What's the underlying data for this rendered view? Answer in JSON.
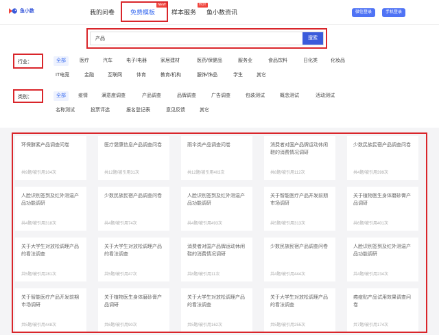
{
  "header": {
    "logo_text": "鱼小数",
    "nav": [
      {
        "label": "我的问卷"
      },
      {
        "label": "免费模板",
        "badge": "NEW"
      },
      {
        "label": "样本服务",
        "badge": "HOT"
      },
      {
        "label": "鱼小数资讯"
      }
    ],
    "login_wechat": "微信登录",
    "login_phone": "手机登录"
  },
  "search": {
    "value": "产品",
    "button": "搜索"
  },
  "industry": {
    "label": "行业：",
    "items": [
      "全部",
      "医疗",
      "汽车",
      "电子/电器",
      "家居建材",
      "医药/保健品",
      "服务业",
      "食品饮料",
      "日化类",
      "化妆品",
      "IT电竞",
      "金融",
      "互联网",
      "体育",
      "教育/机构",
      "服饰/饰品",
      "学生",
      "其它"
    ]
  },
  "category": {
    "label": "类别：",
    "items": [
      "全部",
      "疫情",
      "满意度调查",
      "产品调查",
      "品牌调查",
      "广告调查",
      "包装测试",
      "概念测试",
      "活动测试",
      "名称测试",
      "投票评选",
      "报名登记表",
      "意见反馈",
      "其它"
    ]
  },
  "cards": [
    {
      "title": "环保酵素产品调查问卷",
      "meta": "共9题/被引用104次"
    },
    {
      "title": "医疗健康信息产品调查问卷",
      "meta": "共12题/被引用31次"
    },
    {
      "title": "雨伞类产品调查问卷",
      "meta": "共12题/被引用403次"
    },
    {
      "title": "消费者对国产品牌运动休闲鞋的消费情况调研",
      "meta": "共8题/被引用112次"
    },
    {
      "title": "少数民族民宿产品调查问卷",
      "meta": "共4题/被引用399次"
    },
    {
      "title": "人脸识别签到及红外测温产品功能调研",
      "meta": "共4题/被引用318次"
    },
    {
      "title": "少数民族民宿产品调查问卷",
      "meta": "共4题/被引用74次"
    },
    {
      "title": "人脸识别签到及红外测温产品功能调研",
      "meta": "共4题/被引用493次"
    },
    {
      "title": "关于智能医疗产品开发前期市场调研",
      "meta": "共5题/被引用313次"
    },
    {
      "title": "关于植物医生身体磨砂膏产品调研",
      "meta": "共6题/被引用401次"
    },
    {
      "title": "关于大学生对放松调理产品的看法调查",
      "meta": "共5题/被引用281次"
    },
    {
      "title": "关于大学生对放松调理产品的看法调查",
      "meta": "共5题/被引用47次"
    },
    {
      "title": "消费者对国产品牌运动休闲鞋的消费情况调研",
      "meta": "共8题/被引用11次"
    },
    {
      "title": "少数民族民宿产品调查问卷",
      "meta": "共4题/被引用444次"
    },
    {
      "title": "人脸识别签到及红外测温产品功能调研",
      "meta": "共4题/被引用234次"
    },
    {
      "title": "关于智能医疗产品开发前期市场调研",
      "meta": "共5题/被引用448次"
    },
    {
      "title": "关于植物医生身体磨砂膏产品调研",
      "meta": "共6题/被引用90次"
    },
    {
      "title": "关于大学生对放松调理产品的看法调查",
      "meta": "共5题/被引用162次"
    },
    {
      "title": "关于大学生对放松调理产品的看法调查",
      "meta": "共5题/被引用255次"
    },
    {
      "title": "癌痘贴产品试用效果调查问卷",
      "meta": "共7题/被引用174次"
    }
  ],
  "colors": {
    "accent": "#3b6df0",
    "highlight_box": "#d9252a",
    "search_button": "#3b5bdb"
  }
}
